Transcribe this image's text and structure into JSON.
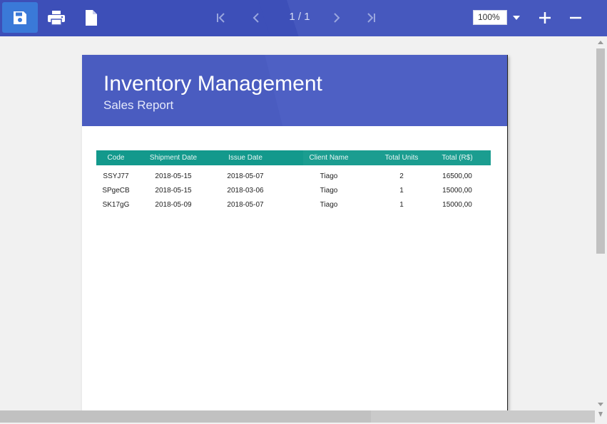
{
  "toolbar": {
    "save_icon": "floppy-disk-icon",
    "print_icon": "printer-icon",
    "document_icon": "document-icon",
    "page_indicator": "1 / 1",
    "zoom_value": "100%",
    "accent_color": "#4658be",
    "active_color": "#3a79d8"
  },
  "report": {
    "title": "Inventory Management",
    "subtitle": "Sales Report",
    "header_color": "#4a5cc0",
    "table_header_color": "#13998c",
    "columns": [
      "Code",
      "Shipment Date",
      "Issue Date",
      "Client Name",
      "Total Units",
      "Total (R$)"
    ],
    "rows": [
      [
        "SSYJ77",
        "2018-05-15",
        "2018-05-07",
        "Tiago",
        "2",
        "16500,00"
      ],
      [
        "SPgeCB",
        "2018-05-15",
        "2018-03-06",
        "Tiago",
        "1",
        "15000,00"
      ],
      [
        "SK17gG",
        "2018-05-09",
        "2018-05-07",
        "Tiago",
        "1",
        "15000,00"
      ]
    ]
  }
}
